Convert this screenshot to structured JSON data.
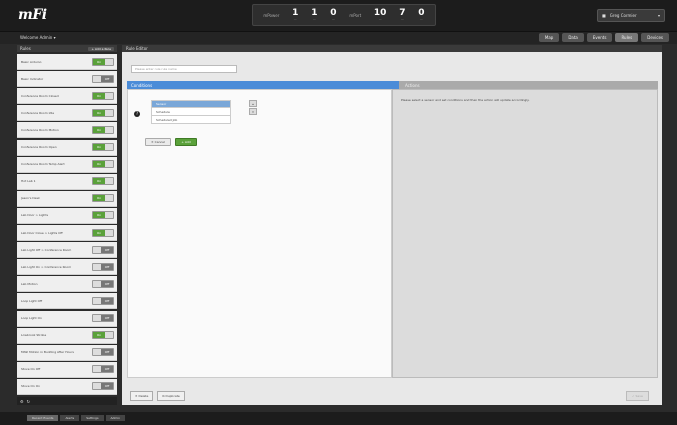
{
  "app": {
    "logo": "mFi"
  },
  "stats": {
    "mpower_label": "mPower",
    "mport_label": "mPort",
    "items": [
      {
        "num": "1",
        "sub": "—"
      },
      {
        "num": "1",
        "sub": "—"
      },
      {
        "num": "0",
        "sub": "—"
      },
      {
        "num": "10",
        "sub": "—"
      },
      {
        "num": "7",
        "sub": "—"
      },
      {
        "num": "0",
        "sub": "—"
      }
    ]
  },
  "user": {
    "name": "Greg Cormier"
  },
  "subbar": {
    "welcome": "Welcome Admin",
    "tabs": [
      "Map",
      "Data",
      "Events",
      "Rules",
      "Devices"
    ],
    "active_tab": "Rules"
  },
  "sidebar": {
    "title": "Rules",
    "add_rule": "+ Add a Rule",
    "rules": [
      {
        "name": "Basic Arduino",
        "on": true
      },
      {
        "name": "Basic Indicator",
        "on": false
      },
      {
        "name": "Conference Room Closed",
        "on": true
      },
      {
        "name": "Conference Room Idle",
        "on": true
      },
      {
        "name": "Conference Room Motion",
        "on": true
      },
      {
        "name": "Conference Room Open",
        "on": true
      },
      {
        "name": "Conference Room Temp Alert",
        "on": true
      },
      {
        "name": "Hot Lab 1",
        "on": true
      },
      {
        "name": "Jason's Desk",
        "on": true
      },
      {
        "name": "Lab Door > Lights",
        "on": true
      },
      {
        "name": "Lab Door Close > Lights Off",
        "on": true
      },
      {
        "name": "Lab Light Off > Conference Room",
        "on": false
      },
      {
        "name": "Lab Light On > Conference Room",
        "on": false
      },
      {
        "name": "Lab Motion",
        "on": false
      },
      {
        "name": "Loop Light Off",
        "on": false
      },
      {
        "name": "Loop Light On",
        "on": false
      },
      {
        "name": "Lowbrook Strobe",
        "on": true
      },
      {
        "name": "MiWi Motion in Building After Hours",
        "on": false
      },
      {
        "name": "Stove On Off",
        "on": false
      },
      {
        "name": "Stove On On",
        "on": false
      }
    ],
    "on_label": "On",
    "off_label": "Off"
  },
  "main": {
    "title": "Rule Editor",
    "rule_name_placeholder": "Please enter rule rule name",
    "conditions_label": "Conditions",
    "actions_label": "Actions",
    "actions_message": "Please select a sensor and set conditions and then the action will update accordingly.",
    "dropdown_items": [
      "Sensor",
      "Schedule",
      "Scheduled Job"
    ],
    "cancel_label": "Cancel",
    "add_label": "Add",
    "delete_label": "Delete",
    "duplicate_label": "Duplicate",
    "save_label": "Save"
  },
  "bottom_tabs": [
    "Recent Events",
    "Alerts",
    "Settings",
    "Admin"
  ]
}
